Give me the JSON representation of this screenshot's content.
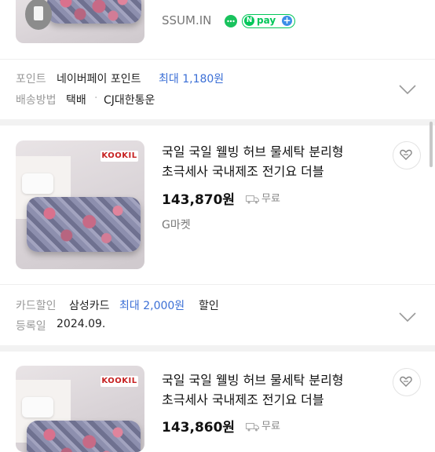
{
  "top_item": {
    "seller": "SSUM.IN",
    "npay_label": "pay"
  },
  "top_info": {
    "point_label": "포인트",
    "point_text": "네이버페이 포인트",
    "point_max": "최대 1,180원",
    "delivery_label": "배송방법",
    "delivery_text": "택배",
    "delivery_company": "CJ대한통운"
  },
  "item1": {
    "logo": "KOOKIL",
    "title_line1": "국일 국일 웰빙 허브 물세탁 분리형",
    "title_line2": "초극세사 국내제조 전기요 더블",
    "price": "143,870원",
    "shipping": "무료",
    "seller": "G마켓",
    "card_label": "카드할인",
    "card_name": "삼성카드",
    "card_max": "최대 2,000원",
    "card_suffix": "할인",
    "reg_label": "등록일",
    "reg_date": "2024.09."
  },
  "item2": {
    "logo": "KOOKIL",
    "title_line1": "국일 국일 웰빙 허브 물세탁 분리형",
    "title_line2": "초극세사 국내제조 전기요 더블",
    "price": "143,860원",
    "shipping": "무료"
  },
  "colors": {
    "accent_blue": "#3b6fd6",
    "npay_green": "#03c75a",
    "talk_green": "#19c25d"
  },
  "icons": [
    "chat-bubble-icon",
    "npay-icon",
    "plus-icon",
    "truck-icon",
    "heart-icon",
    "chevron-down-icon"
  ]
}
